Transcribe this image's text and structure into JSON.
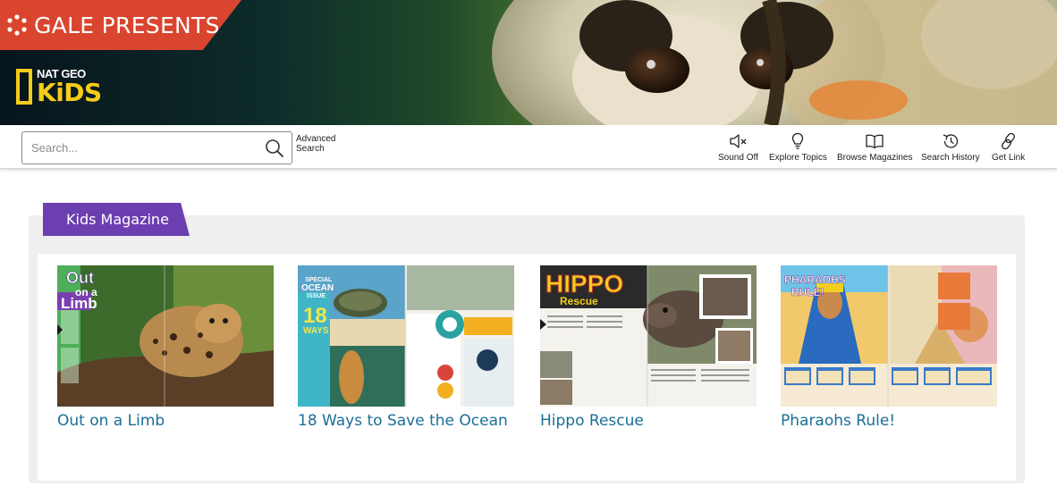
{
  "header": {
    "brand_label": "GALE PRESENTS",
    "product_logo": {
      "top": "NAT GEO",
      "main": "KiDS"
    }
  },
  "toolbar": {
    "search": {
      "placeholder": "Search...",
      "value": ""
    },
    "advanced_search_label": "Advanced Search",
    "actions": [
      {
        "label": "Sound Off",
        "icon": "sound-off-icon"
      },
      {
        "label": "Explore Topics",
        "icon": "lightbulb-icon"
      },
      {
        "label": "Browse Magazines",
        "icon": "open-book-icon"
      },
      {
        "label": "Search History",
        "icon": "history-icon"
      },
      {
        "label": "Get Link",
        "icon": "link-icon"
      }
    ]
  },
  "main": {
    "section_title": "Kids Magazine",
    "articles": [
      {
        "title": "Out on a Limb",
        "cover_text": [
          "Out",
          "on a",
          "Limb"
        ]
      },
      {
        "title": "18 Ways to Save the Ocean",
        "cover_text": [
          "SPECIAL",
          "OCEAN",
          "ISSUE",
          "18",
          "WAYS"
        ]
      },
      {
        "title": "Hippo Rescue",
        "cover_text": [
          "HIPPO",
          "Rescue"
        ]
      },
      {
        "title": "Pharaohs Rule!",
        "cover_text": [
          "PHARAOHS",
          "RULE!"
        ]
      }
    ]
  },
  "colors": {
    "brand_red": "#d9452e",
    "natgeo_yellow": "#f6cc1a",
    "section_purple": "#6c3fb0",
    "link_blue": "#1a6e96"
  }
}
